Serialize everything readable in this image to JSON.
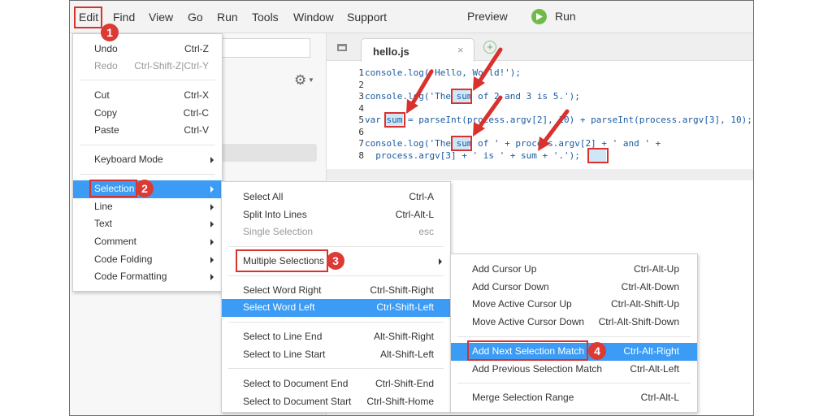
{
  "menubar": {
    "items": [
      "Edit",
      "Find",
      "View",
      "Go",
      "Run",
      "Tools",
      "Window",
      "Support"
    ],
    "preview": "Preview",
    "run": "Run"
  },
  "editor": {
    "tab_name": "hello.js",
    "tab_close": "×",
    "tab_add": "+",
    "line_numbers": [
      "1",
      "2",
      "3",
      "4",
      "5",
      "6",
      "7",
      "8"
    ],
    "code_lines": [
      "console.log('Hello, World!');",
      "",
      "console.log('The sum of 2 and 3 is 5.');",
      "",
      "var sum = parseInt(process.argv[2], 10) + parseInt(process.argv[3], 10);",
      "",
      "console.log('The sum of ' + process.argv[2] + ' and ' +",
      "  process.argv[3] + ' is ' + sum + '.');"
    ]
  },
  "edit_menu": {
    "items": [
      {
        "label": "Undo",
        "shortcut": "Ctrl-Z"
      },
      {
        "label": "Redo",
        "shortcut": "Ctrl-Shift-Z|Ctrl-Y"
      },
      {
        "label": "Cut",
        "shortcut": "Ctrl-X"
      },
      {
        "label": "Copy",
        "shortcut": "Ctrl-C"
      },
      {
        "label": "Paste",
        "shortcut": "Ctrl-V"
      },
      {
        "label": "Keyboard Mode"
      },
      {
        "label": "Selection"
      },
      {
        "label": "Line"
      },
      {
        "label": "Text"
      },
      {
        "label": "Comment"
      },
      {
        "label": "Code Folding"
      },
      {
        "label": "Code Formatting"
      }
    ]
  },
  "selection_menu": {
    "items": [
      {
        "label": "Select All",
        "shortcut": "Ctrl-A"
      },
      {
        "label": "Split Into Lines",
        "shortcut": "Ctrl-Alt-L"
      },
      {
        "label": "Single Selection",
        "shortcut": "esc"
      },
      {
        "label": "Multiple Selections"
      },
      {
        "label": "Select Word Right",
        "shortcut": "Ctrl-Shift-Right"
      },
      {
        "label": "Select Word Left",
        "shortcut": "Ctrl-Shift-Left"
      },
      {
        "label": "Select to Line End",
        "shortcut": "Alt-Shift-Right"
      },
      {
        "label": "Select to Line Start",
        "shortcut": "Alt-Shift-Left"
      },
      {
        "label": "Select to Document End",
        "shortcut": "Ctrl-Shift-End"
      },
      {
        "label": "Select to Document Start",
        "shortcut": "Ctrl-Shift-Home"
      }
    ]
  },
  "multiple_menu": {
    "items": [
      {
        "label": "Add Cursor Up",
        "shortcut": "Ctrl-Alt-Up"
      },
      {
        "label": "Add Cursor Down",
        "shortcut": "Ctrl-Alt-Down"
      },
      {
        "label": "Move Active Cursor Up",
        "shortcut": "Ctrl-Alt-Shift-Up"
      },
      {
        "label": "Move Active Cursor Down",
        "shortcut": "Ctrl-Alt-Shift-Down"
      },
      {
        "label": "Add Next Selection Match",
        "shortcut": "Ctrl-Alt-Right"
      },
      {
        "label": "Add Previous Selection Match",
        "shortcut": "Ctrl-Alt-Left"
      },
      {
        "label": "Merge Selection Range",
        "shortcut": "Ctrl-Alt-L"
      }
    ]
  },
  "badges": [
    "1",
    "2",
    "3",
    "4"
  ],
  "colors": {
    "highlight": "#3c9cf5",
    "annotation": "#d9312d",
    "run_icon": "#6fba4a"
  }
}
